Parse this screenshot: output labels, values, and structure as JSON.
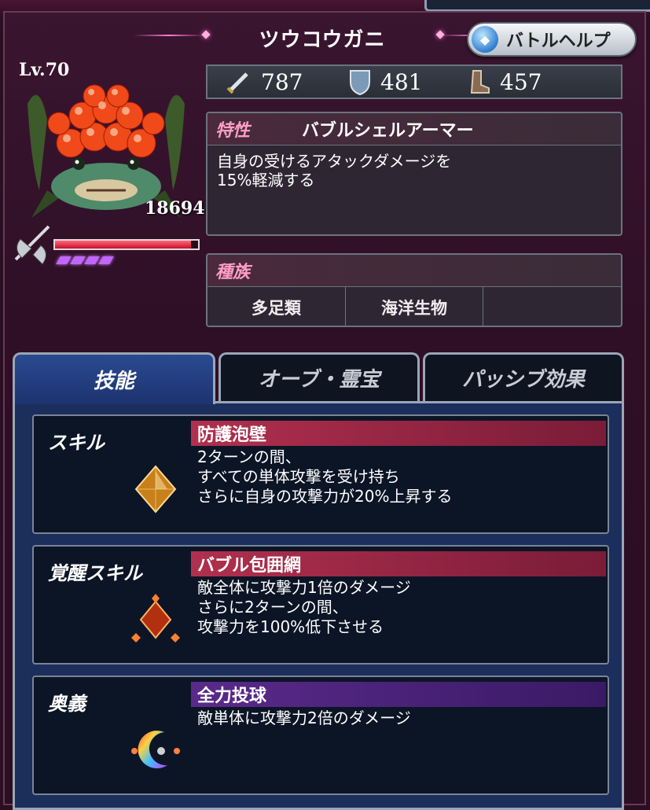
{
  "header": {
    "title": "ツウコウガニ",
    "help_button": "バトルヘルプ"
  },
  "unit": {
    "level": "Lv.70",
    "hp": "18694",
    "hp_fraction": 0.95,
    "stats": {
      "attack": "787",
      "defense": "481",
      "speed": "457"
    }
  },
  "trait": {
    "label": "特性",
    "name": "バブルシェルアーマー",
    "desc_line1": "自身の受けるアタックダメージを",
    "desc_line2": "15%軽減する"
  },
  "race": {
    "label": "種族",
    "types": [
      "多足類",
      "海洋生物",
      ""
    ]
  },
  "tabs": [
    "技能",
    "オーブ・霊宝",
    "パッシブ効果"
  ],
  "skills": [
    {
      "type": "スキル",
      "name": "防護泡壁",
      "lines": [
        "2ターンの間、",
        "すべての単体攻撃を受け持ち",
        "さらに自身の攻撃力が20%上昇する"
      ]
    },
    {
      "type": "覚醒スキル",
      "name": "バブル包囲網",
      "lines": [
        "敵全体に攻撃力1倍のダメージ",
        "さらに2ターンの間、",
        "攻撃力を100%低下させる"
      ]
    },
    {
      "type": "奥義",
      "name": "全力投球",
      "lines": [
        "敵単体に攻撃力2倍のダメージ",
        "",
        ""
      ]
    }
  ],
  "colors": {
    "hp_bar": "#c8102a",
    "trait_label": "#ff9ec4",
    "active_tab": "#1c3470"
  }
}
